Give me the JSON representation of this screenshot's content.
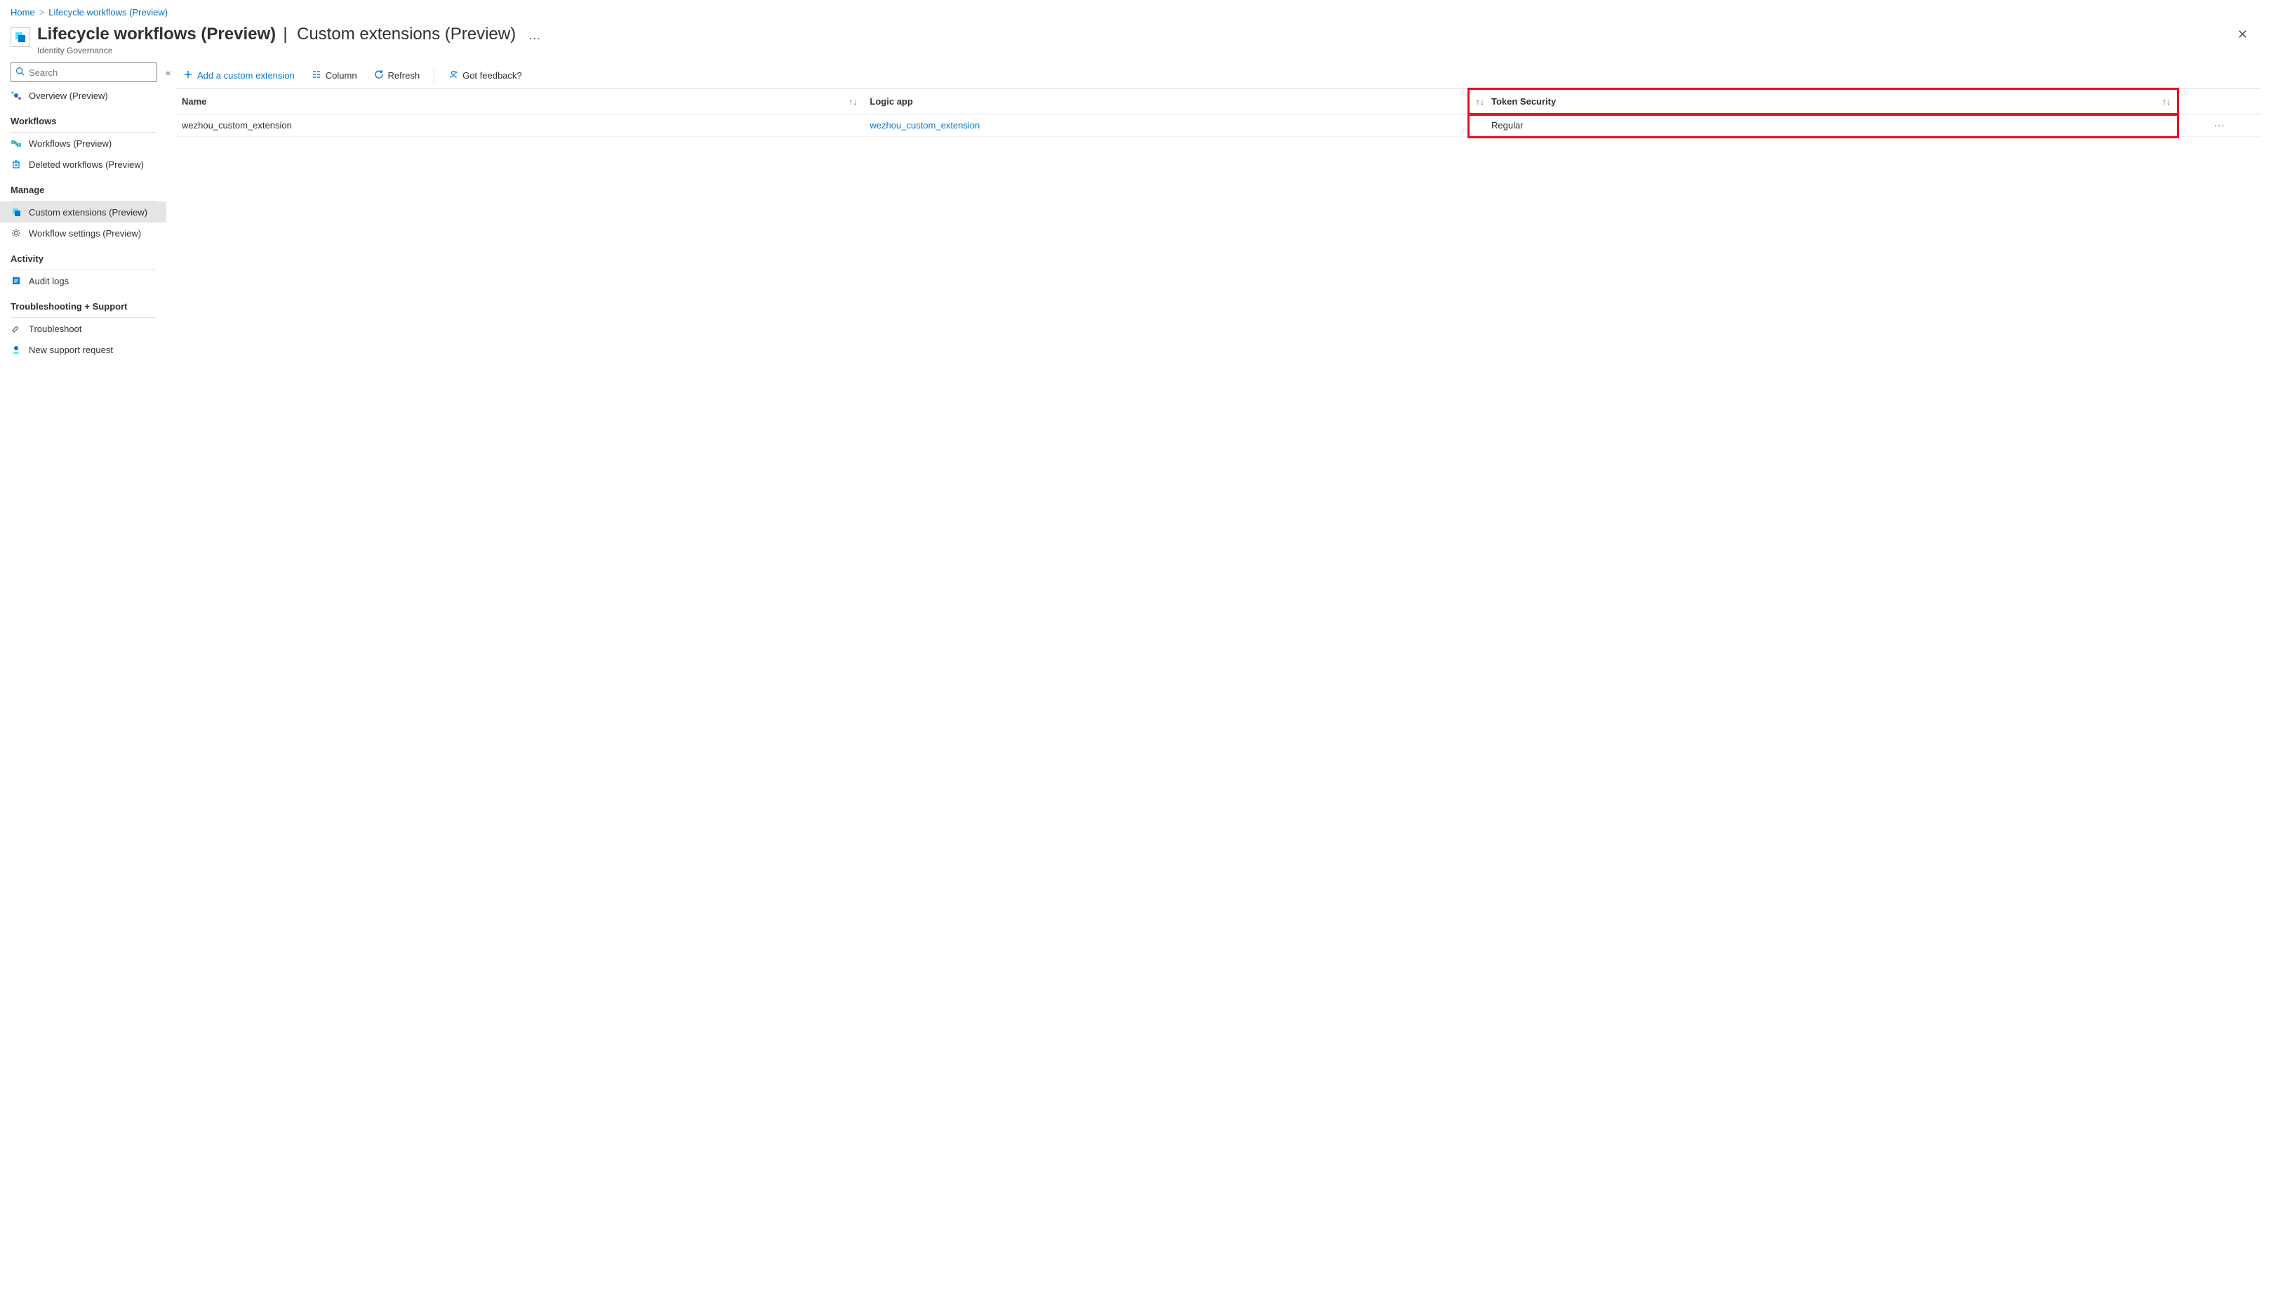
{
  "breadcrumb": {
    "home": "Home",
    "current": "Lifecycle workflows (Preview)"
  },
  "header": {
    "title": "Lifecycle workflows (Preview)",
    "separator": "|",
    "sub_title": "Custom extensions (Preview)",
    "subtitle": "Identity Governance",
    "more_actions": "…"
  },
  "sidebar": {
    "search_placeholder": "Search",
    "overview_label": "Overview (Preview)",
    "sections": {
      "workflows_label": "Workflows",
      "manage_label": "Manage",
      "activity_label": "Activity",
      "troubleshoot_label": "Troubleshooting + Support"
    },
    "items": {
      "workflows": "Workflows (Preview)",
      "deleted_workflows": "Deleted workflows (Preview)",
      "custom_extensions": "Custom extensions (Preview)",
      "workflow_settings": "Workflow settings (Preview)",
      "audit_logs": "Audit logs",
      "troubleshoot": "Troubleshoot",
      "new_support_request": "New support request"
    }
  },
  "toolbar": {
    "add": "Add a custom extension",
    "column": "Column",
    "refresh": "Refresh",
    "feedback": "Got feedback?"
  },
  "table": {
    "columns": {
      "name": "Name",
      "logic_app": "Logic app",
      "token_security": "Token Security"
    },
    "rows": [
      {
        "name": "wezhou_custom_extension",
        "logic_app": "wezhou_custom_extension",
        "token_security": "Regular"
      }
    ]
  },
  "annotations": {
    "highlighted_column": "token_security"
  }
}
